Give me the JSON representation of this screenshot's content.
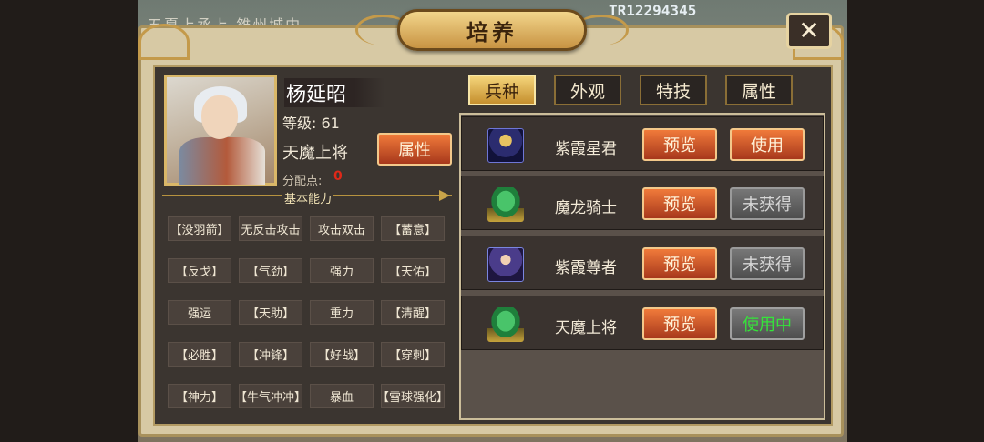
{
  "hud": {
    "top_text": "五夏上丞上 雒州城内",
    "player_id": "TR12294345"
  },
  "dialog": {
    "title": "培养",
    "close_icon": "close-icon"
  },
  "hero": {
    "name": "杨延昭",
    "level": "等级: 61",
    "title": "天魔上将",
    "points_label": "分配点:",
    "points_value": "0",
    "attr_button": "属性"
  },
  "skills_section": {
    "title": "基本能力",
    "skills": [
      "【没羽箭】",
      "无反击攻击",
      "攻击双击",
      "【蓄意】",
      "【反戈】",
      "【气劲】",
      "强力",
      "【天佑】",
      "强运",
      "【天助】",
      "重力",
      "【清醒】",
      "【必胜】",
      "【冲锋】",
      "【好战】",
      "【穿刺】",
      "【神力】",
      "【牛气冲冲】",
      "暴血",
      "【雪球强化】"
    ]
  },
  "tabs": [
    {
      "label": "兵种",
      "active": true
    },
    {
      "label": "外观",
      "active": false
    },
    {
      "label": "特技",
      "active": false
    },
    {
      "label": "属性",
      "active": false
    }
  ],
  "units": [
    {
      "name": "紫霞星君",
      "icon": "knight-unit-icon",
      "preview": "预览",
      "action": "使用",
      "state": "use"
    },
    {
      "name": "魔龙骑士",
      "icon": "jade-dragon-unit-icon",
      "preview": "预览",
      "action": "未获得",
      "state": "locked"
    },
    {
      "name": "紫霞尊者",
      "icon": "mage-unit-icon",
      "preview": "预览",
      "action": "未获得",
      "state": "locked"
    },
    {
      "name": "天魔上将",
      "icon": "jade-dragon-unit-icon",
      "preview": "预览",
      "action": "使用中",
      "state": "inuse"
    }
  ]
}
